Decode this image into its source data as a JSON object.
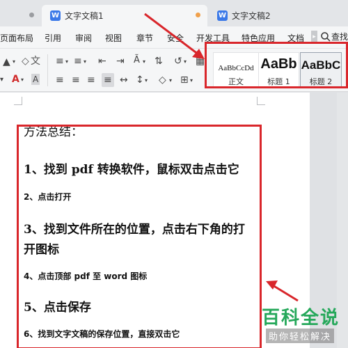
{
  "tabs": {
    "active_title": "文字文稿1",
    "inactive_title": "文字文稿2",
    "doc_icon_letter": "W"
  },
  "menu": {
    "items": [
      "页面布局",
      "引用",
      "审阅",
      "视图",
      "章节",
      "安全",
      "开发工具",
      "特色应用",
      "文档"
    ],
    "search_label": "查找"
  },
  "ribbon": {
    "styles": [
      {
        "sample": "AaBbCcDd",
        "name": "正文"
      },
      {
        "sample": "AaBb",
        "name": "标题 1"
      },
      {
        "sample": "AaBbC",
        "name": "标题 2"
      }
    ]
  },
  "document": {
    "lines": [
      "方法总结：",
      "1、找到 pdf 转换软件，鼠标双击点击它",
      "2、点击打开",
      "3、找到文件所在的位置，点击右下角的打",
      "开图标",
      "4、点击顶部 pdf 至 word 图标",
      "5、点击保存",
      "6、找到文字文稿的保存位置，直接双击它"
    ]
  },
  "watermark": {
    "title": "百科全说",
    "subtitle": "助你轻松解决"
  },
  "colors": {
    "annotation_red": "#d9262b",
    "doc_icon_blue": "#3b79e8",
    "watermark_green": "#25a85a"
  }
}
